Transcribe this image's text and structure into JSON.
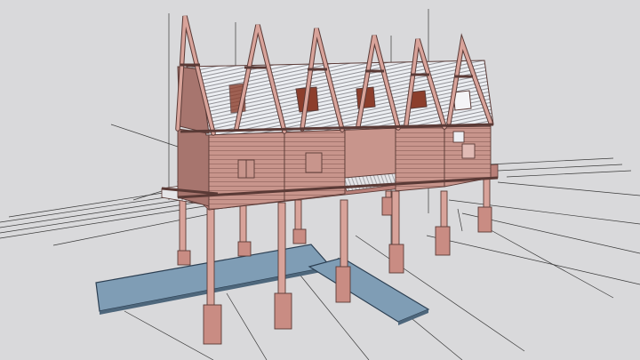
{
  "viewport": {
    "background": "#d9d9db",
    "subject": "stilt-house-model"
  },
  "colors": {
    "wall": "#c8958c",
    "wall_dark": "#a7756e",
    "timber": "#d8a39a",
    "timber_edge": "#5a3a36",
    "roof": "#eceef2",
    "roof_line": "#6b6b70",
    "walkway": "#7f9db5",
    "walkway_edge": "#2c3f52",
    "grid_line": "#3a3a3a",
    "window_dark": "#8c3e2c"
  }
}
